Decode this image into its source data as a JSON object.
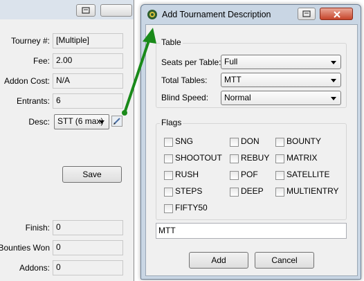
{
  "left_panel": {
    "fields": [
      {
        "label": "Tourney #:",
        "value": "[Multiple]"
      },
      {
        "label": "Fee:",
        "value": "2.00"
      },
      {
        "label": "Addon Cost:",
        "value": "N/A"
      },
      {
        "label": "Entrants:",
        "value": "6"
      }
    ],
    "desc_label": "Desc:",
    "desc_value": "STT (6 max)",
    "save_label": "Save",
    "bottom_fields": [
      {
        "label": "Finish:",
        "value": "0"
      },
      {
        "label": "Bounties Won:",
        "value": "0"
      },
      {
        "label": "Addons:",
        "value": "0"
      }
    ]
  },
  "dialog": {
    "title": "Add Tournament Description",
    "table_group": {
      "title": "Table",
      "seats_label": "Seats per Table:",
      "seats_value": "Full",
      "total_label": "Total Tables:",
      "total_value": "MTT",
      "speed_label": "Blind Speed:",
      "speed_value": "Normal"
    },
    "flags_group": {
      "title": "Flags",
      "flags": [
        "SNG",
        "DON",
        "BOUNTY",
        "SHOOTOUT",
        "REBUY",
        "MATRIX",
        "RUSH",
        "POF",
        "SATELLITE",
        "STEPS",
        "DEEP",
        "MULTIENTRY",
        "FIFTY50"
      ]
    },
    "description_value": "MTT",
    "add_label": "Add",
    "cancel_label": "Cancel"
  },
  "colors": {
    "arrow": "#1a8a1a",
    "titlebar": "#c9d6e4",
    "close_button": "#c7452a"
  },
  "icons": [
    "restore-icon",
    "close-icon",
    "app-icon",
    "edit-pencil-icon"
  ]
}
